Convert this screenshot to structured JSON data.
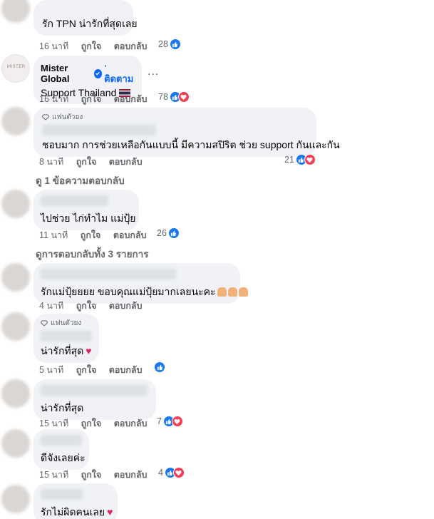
{
  "comments": [
    {
      "text": "รัก TPN น่ารักที่สุดเลย",
      "time": "16 นาที",
      "like": "ถูกใจ",
      "reply": "ตอบกลับ",
      "count": "28"
    },
    {
      "name": "Mister Global",
      "follow": "· ติดตาม",
      "text": "Support Thailand",
      "time": "16 นาที",
      "like": "ถูกใจ",
      "reply": "ตอบกลับ",
      "count": "78",
      "more": "...",
      "avatar_text": "MISTER"
    },
    {
      "badge": "แฟนตัวยง",
      "text": "ชอบมาก การช่วยเหลือกันแบบนี้ มีความสปิริต ช่วย support กันและกัน",
      "time": "8 นาที",
      "like": "ถูกใจ",
      "reply": "ตอบกลับ",
      "count": "21",
      "replies": "ดู 1 ข้อความตอบกลับ"
    },
    {
      "text": "ไปช่วย  ไก่ทำไม แม่ปุ้ย",
      "time": "11 นาที",
      "like": "ถูกใจ",
      "reply": "ตอบกลับ",
      "count": "26",
      "replies": "ดูการตอบกลับทั้ง 3 รายการ"
    },
    {
      "text": "รักแม่ปุ้ยยยย ขอบคุณแม่ปุ้ยมากเลยนะคะ",
      "time": "4 นาที",
      "like": "ถูกใจ",
      "reply": "ตอบกลับ"
    },
    {
      "badge": "แฟนตัวยง",
      "text": "น่ารักที่สุด",
      "time": "5 นาที",
      "like": "ถูกใจ",
      "reply": "ตอบกลับ"
    },
    {
      "text": "น่ารักที่สุด",
      "time": "15 นาที",
      "like": "ถูกใจ",
      "reply": "ตอบกลับ",
      "count": "7"
    },
    {
      "text": "ดีจังเลยค่ะ",
      "time": "15 นาที",
      "like": "ถูกใจ",
      "reply": "ตอบกลับ",
      "count": "4"
    },
    {
      "text": "รักไม่ผิดคนเลย"
    }
  ],
  "colors": {
    "like": "#1877f2",
    "love": "#f33e58",
    "bubble": "#f0f2f5",
    "meta": "#65676b",
    "follow": "#0866ff"
  },
  "icons": {
    "like": "thumbs-up-icon",
    "love": "heart-icon",
    "verified": "verified-badge-icon",
    "badge": "diamond-icon"
  }
}
